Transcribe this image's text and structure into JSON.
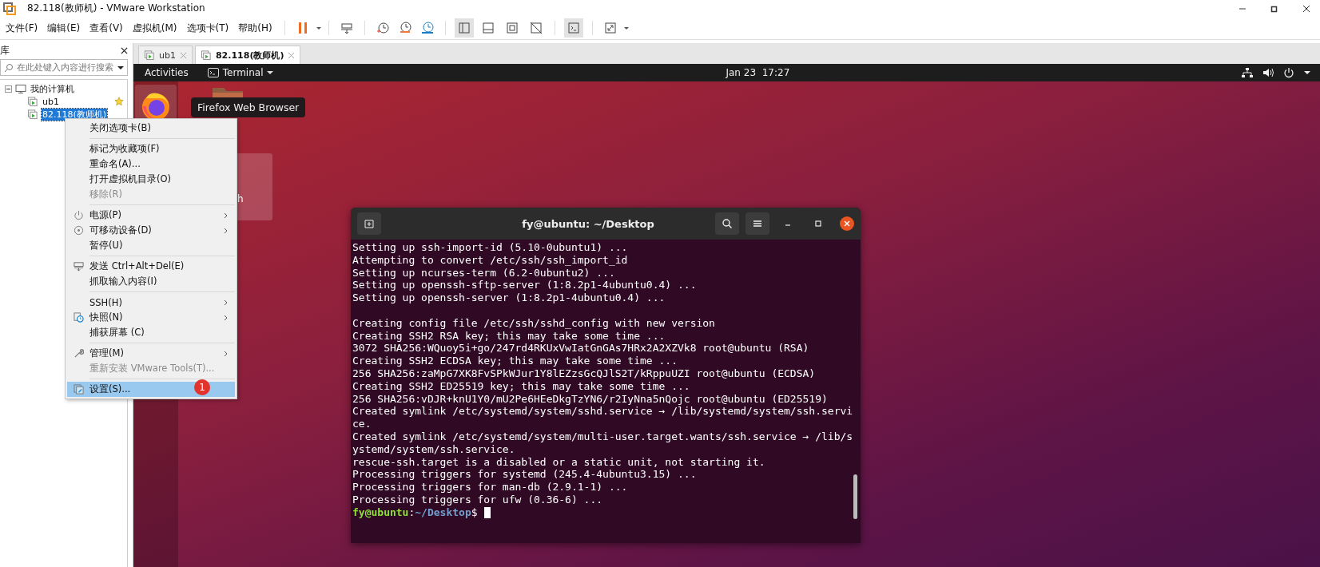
{
  "window": {
    "title": "82.118(教师机) - VMware Workstation"
  },
  "menu_bar": [
    "文件(F)",
    "编辑(E)",
    "查看(V)",
    "虚拟机(M)",
    "选项卡(T)",
    "帮助(H)"
  ],
  "view_buttons": [
    {
      "on": true
    },
    {
      "on": false
    },
    {
      "on": false
    },
    {
      "on": false
    }
  ],
  "console_button": {
    "on": true
  },
  "library": {
    "title": "库",
    "search": {
      "placeholder": "在此处键入内容进行搜索"
    },
    "tree": [
      {
        "label": "我的计算机",
        "expanded": true,
        "children": [
          {
            "label": "ub1",
            "selected": false,
            "favorite": true
          },
          {
            "label": "82.118(教师机)",
            "selected": true,
            "favorite": false
          }
        ]
      }
    ]
  },
  "tabs": [
    {
      "label": "ub1",
      "selected": false
    },
    {
      "label": "82.118(教师机)",
      "selected": true
    }
  ],
  "guest": {
    "top_bar": {
      "activities": "Activities",
      "app_menu": "Terminal",
      "clock": "Jan 23  17:27"
    },
    "tooltip": "Firefox Web Browser",
    "desktop_label": "h",
    "terminal": {
      "title": "fy@ubuntu: ~/Desktop",
      "blocks": [
        [
          "Setting up ssh-import-id (5.10-0ubuntu1) ...",
          "Attempting to convert /etc/ssh/ssh_import_id",
          "Setting up ncurses-term (6.2-0ubuntu2) ...",
          "Setting up openssh-sftp-server (1:8.2p1-4ubuntu0.4) ...",
          "Setting up openssh-server (1:8.2p1-4ubuntu0.4) ..."
        ],
        [
          "Creating config file /etc/ssh/sshd_config with new version",
          "Creating SSH2 RSA key; this may take some time ...",
          "3072 SHA256:WQuoy5i+go/247rd4RKUxVwIatGnGAs7HRx2A2XZVk8 root@ubuntu (RSA)",
          "Creating SSH2 ECDSA key; this may take some time ...",
          "256 SHA256:zaMpG7XK8FvSPkWJur1Y8lEZzsGcQJlS2T/kRppuUZI root@ubuntu (ECDSA)",
          "Creating SSH2 ED25519 key; this may take some time ...",
          "256 SHA256:vDJR+knU1Y0/mU2Pe6HEeDkgTzYN6/r2IyNna5nQojc root@ubuntu (ED25519)",
          "Created symlink /etc/systemd/system/sshd.service → /lib/systemd/system/ssh.servi",
          "ce.",
          "Created symlink /etc/systemd/system/multi-user.target.wants/ssh.service → /lib/s",
          "ystemd/system/ssh.service.",
          "rescue-ssh.target is a disabled or a static unit, not starting it.",
          "Processing triggers for systemd (245.4-4ubuntu3.15) ...",
          "Processing triggers for man-db (2.9.1-1) ...",
          "Processing triggers for ufw (0.36-6) ..."
        ]
      ],
      "prompt": {
        "user": "fy@ubuntu",
        "separator": ":",
        "path": "~/Desktop",
        "symbol": "$"
      }
    }
  },
  "context_menu": {
    "groups": [
      [
        {
          "label": "关闭选项卡(B)",
          "kind": "plain",
          "disabled": false,
          "submenu": false,
          "selected": false
        }
      ],
      [
        {
          "label": "标记为收藏项(F)",
          "kind": "plain",
          "disabled": false,
          "submenu": false,
          "selected": false
        },
        {
          "label": "重命名(A)...",
          "kind": "plain",
          "disabled": false,
          "submenu": false,
          "selected": false
        },
        {
          "label": "打开虚拟机目录(O)",
          "kind": "plain",
          "disabled": false,
          "submenu": false,
          "selected": false
        },
        {
          "label": "移除(R)",
          "kind": "plain",
          "disabled": true,
          "submenu": false,
          "selected": false
        }
      ],
      [
        {
          "label": "电源(P)",
          "kind": "power",
          "disabled": false,
          "submenu": true,
          "selected": false
        },
        {
          "label": "可移动设备(D)",
          "kind": "device",
          "disabled": false,
          "submenu": true,
          "selected": false
        },
        {
          "label": "暂停(U)",
          "kind": "plain",
          "disabled": false,
          "submenu": false,
          "selected": false
        }
      ],
      [
        {
          "label": "发送 Ctrl+Alt+Del(E)",
          "kind": "keys",
          "disabled": false,
          "submenu": false,
          "selected": false
        },
        {
          "label": "抓取输入内容(I)",
          "kind": "plain",
          "disabled": false,
          "submenu": false,
          "selected": false
        }
      ],
      [
        {
          "label": "SSH(H)",
          "kind": "plain",
          "disabled": false,
          "submenu": true,
          "selected": false
        },
        {
          "label": "快照(N)",
          "kind": "snapshot",
          "disabled": false,
          "submenu": true,
          "selected": false
        },
        {
          "label": "捕获屏幕 (C)",
          "kind": "plain",
          "disabled": false,
          "submenu": false,
          "selected": false
        }
      ],
      [
        {
          "label": "管理(M)",
          "kind": "wrench",
          "disabled": false,
          "submenu": true,
          "selected": false
        },
        {
          "label": "重新安装 VMware Tools(T)...",
          "kind": "plain",
          "disabled": true,
          "submenu": false,
          "selected": false
        }
      ],
      [
        {
          "label": "设置(S)...",
          "kind": "settings",
          "disabled": false,
          "submenu": false,
          "selected": true
        }
      ]
    ],
    "badge": "1"
  }
}
